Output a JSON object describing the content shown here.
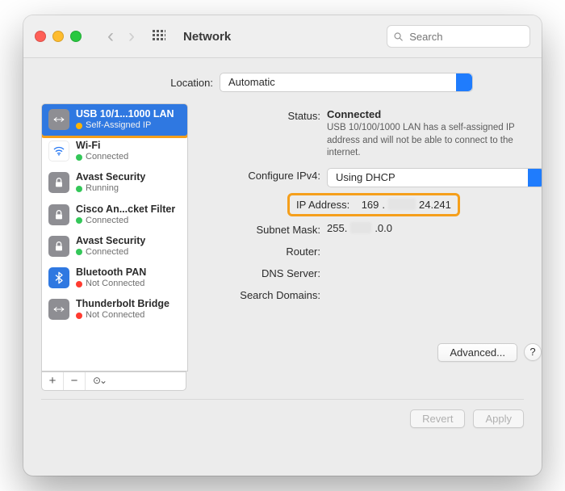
{
  "window_title": "Network",
  "search": {
    "placeholder": "Search"
  },
  "location": {
    "label": "Location:",
    "value": "Automatic"
  },
  "sidebar": {
    "items": [
      {
        "name": "USB 10/1...1000 LAN",
        "status": "Self-Assigned IP",
        "dot": "yellow",
        "icon": "lan"
      },
      {
        "name": "Wi-Fi",
        "status": "Connected",
        "dot": "green",
        "icon": "wifi"
      },
      {
        "name": "Avast Security",
        "status": "Running",
        "dot": "green",
        "icon": "lock"
      },
      {
        "name": "Cisco An...cket Filter",
        "status": "Connected",
        "dot": "green",
        "icon": "lock"
      },
      {
        "name": "Avast Security",
        "status": "Connected",
        "dot": "green",
        "icon": "lock"
      },
      {
        "name": "Bluetooth PAN",
        "status": "Not Connected",
        "dot": "red",
        "icon": "bluetooth"
      },
      {
        "name": "Thunderbolt Bridge",
        "status": "Not Connected",
        "dot": "red",
        "icon": "bridge"
      }
    ],
    "toolbar": {
      "add": "+",
      "remove": "−",
      "more": "⊙⌄"
    }
  },
  "status": {
    "label": "Status:",
    "value": "Connected",
    "description": "USB 10/100/1000 LAN has a self-assigned IP address and will not be able to connect to the internet."
  },
  "configure": {
    "label": "Configure IPv4:",
    "value": "Using DHCP"
  },
  "ip": {
    "label": "IP Address:",
    "part1": "169",
    "part2": "24.241"
  },
  "subnet": {
    "label": "Subnet Mask:",
    "part1": "255.",
    "part2": ".0.0"
  },
  "router": {
    "label": "Router:"
  },
  "dns": {
    "label": "DNS Server:"
  },
  "search_domains": {
    "label": "Search Domains:"
  },
  "buttons": {
    "advanced": "Advanced...",
    "help": "?",
    "revert": "Revert",
    "apply": "Apply"
  }
}
